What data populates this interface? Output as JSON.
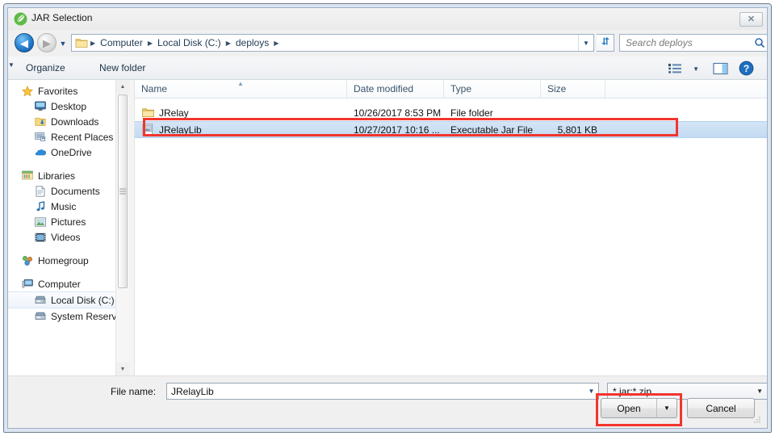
{
  "window": {
    "title": "JAR Selection",
    "app_icon": "spring-leaf-icon",
    "close_label": "✕"
  },
  "nav": {
    "back_icon": "back-arrow-icon",
    "forward_icon": "forward-arrow-icon",
    "history_icon": "chevron-down-icon",
    "refresh_icon": "refresh-icon",
    "breadcrumbs": [
      "Computer",
      "Local Disk (C:)",
      "deploys"
    ],
    "address_dropdown_icon": "chevron-down-icon"
  },
  "search": {
    "placeholder": "Search deploys",
    "icon": "search-icon"
  },
  "toolbar": {
    "organize_label": "Organize",
    "organize_caret": "▼",
    "new_folder_label": "New folder",
    "views_icon": "view-list-icon",
    "views_caret": "▼",
    "preview_pane_icon": "preview-pane-icon",
    "help_icon": "help-icon"
  },
  "sidebar": {
    "groups": [
      {
        "label": "Favorites",
        "icon": "star-icon",
        "items": [
          {
            "label": "Desktop",
            "icon": "desktop-icon"
          },
          {
            "label": "Downloads",
            "icon": "downloads-icon"
          },
          {
            "label": "Recent Places",
            "icon": "recent-places-icon"
          },
          {
            "label": "OneDrive",
            "icon": "onedrive-cloud-icon"
          }
        ]
      },
      {
        "label": "Libraries",
        "icon": "libraries-icon",
        "items": [
          {
            "label": "Documents",
            "icon": "documents-icon"
          },
          {
            "label": "Music",
            "icon": "music-note-icon"
          },
          {
            "label": "Pictures",
            "icon": "pictures-icon"
          },
          {
            "label": "Videos",
            "icon": "videos-icon"
          }
        ]
      },
      {
        "label": "Homegroup",
        "icon": "homegroup-icon",
        "items": []
      },
      {
        "label": "Computer",
        "icon": "computer-icon",
        "items": [
          {
            "label": "Local Disk (C:)",
            "icon": "hard-drive-icon",
            "selected": true
          },
          {
            "label": "System Reserved",
            "icon": "hard-drive-icon"
          }
        ]
      }
    ]
  },
  "file_list": {
    "columns": [
      {
        "label": "Name",
        "sorted": true,
        "sort_icon": "▲"
      },
      {
        "label": "Date modified"
      },
      {
        "label": "Type"
      },
      {
        "label": "Size"
      }
    ],
    "rows": [
      {
        "name": "JRelay",
        "icon": "folder-icon",
        "date_modified": "10/26/2017 8:53 PM",
        "type": "File folder",
        "size": "",
        "selected": false
      },
      {
        "name": "JRelayLib",
        "icon": "jar-file-icon",
        "date_modified": "10/27/2017 10:16 ...",
        "type": "Executable Jar File",
        "size": "5,801 KB",
        "selected": true
      }
    ]
  },
  "footer": {
    "file_name_label": "File name:",
    "file_name_value": "JRelayLib",
    "file_name_dropdown_icon": "chevron-down-icon",
    "filter_value": "*.jar;*.zip",
    "filter_caret": "▼",
    "open_label": "Open",
    "open_dropdown_icon": "▼",
    "cancel_label": "Cancel",
    "resize_grip_icon": "resize-grip-icon"
  },
  "highlights": {
    "color": "#f4342e",
    "targets": [
      "selected-file-row",
      "open-button"
    ]
  }
}
